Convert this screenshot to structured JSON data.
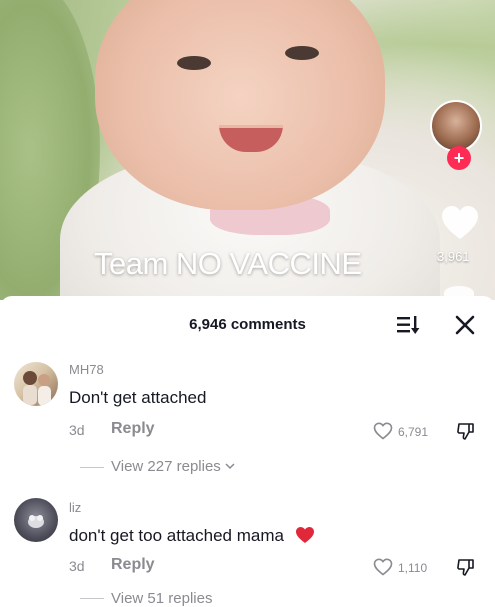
{
  "video": {
    "overlay_text": "Team NO VACCINE",
    "like_count": "3,961",
    "follow_button": "+"
  },
  "comments_sheet": {
    "title": "6,946 comments",
    "icons": {
      "sort": "sort-icon",
      "close": "close-icon"
    },
    "comments": [
      {
        "username": "MH78",
        "text": "Don't get attached",
        "date": "3d",
        "reply_label": "Reply",
        "like_count": "6,791",
        "view_replies": "View 227 replies",
        "has_heart_emoji": false
      },
      {
        "username": "liz",
        "text": "don't get too attached mama",
        "date": "3d",
        "reply_label": "Reply",
        "like_count": "1,110",
        "view_replies": "View 51 replies",
        "has_heart_emoji": true
      }
    ]
  },
  "colors": {
    "accent_pink": "#fe2c55",
    "text_primary": "#161823",
    "text_secondary": "#8a8b91",
    "heart_emoji": "#e0283a"
  }
}
